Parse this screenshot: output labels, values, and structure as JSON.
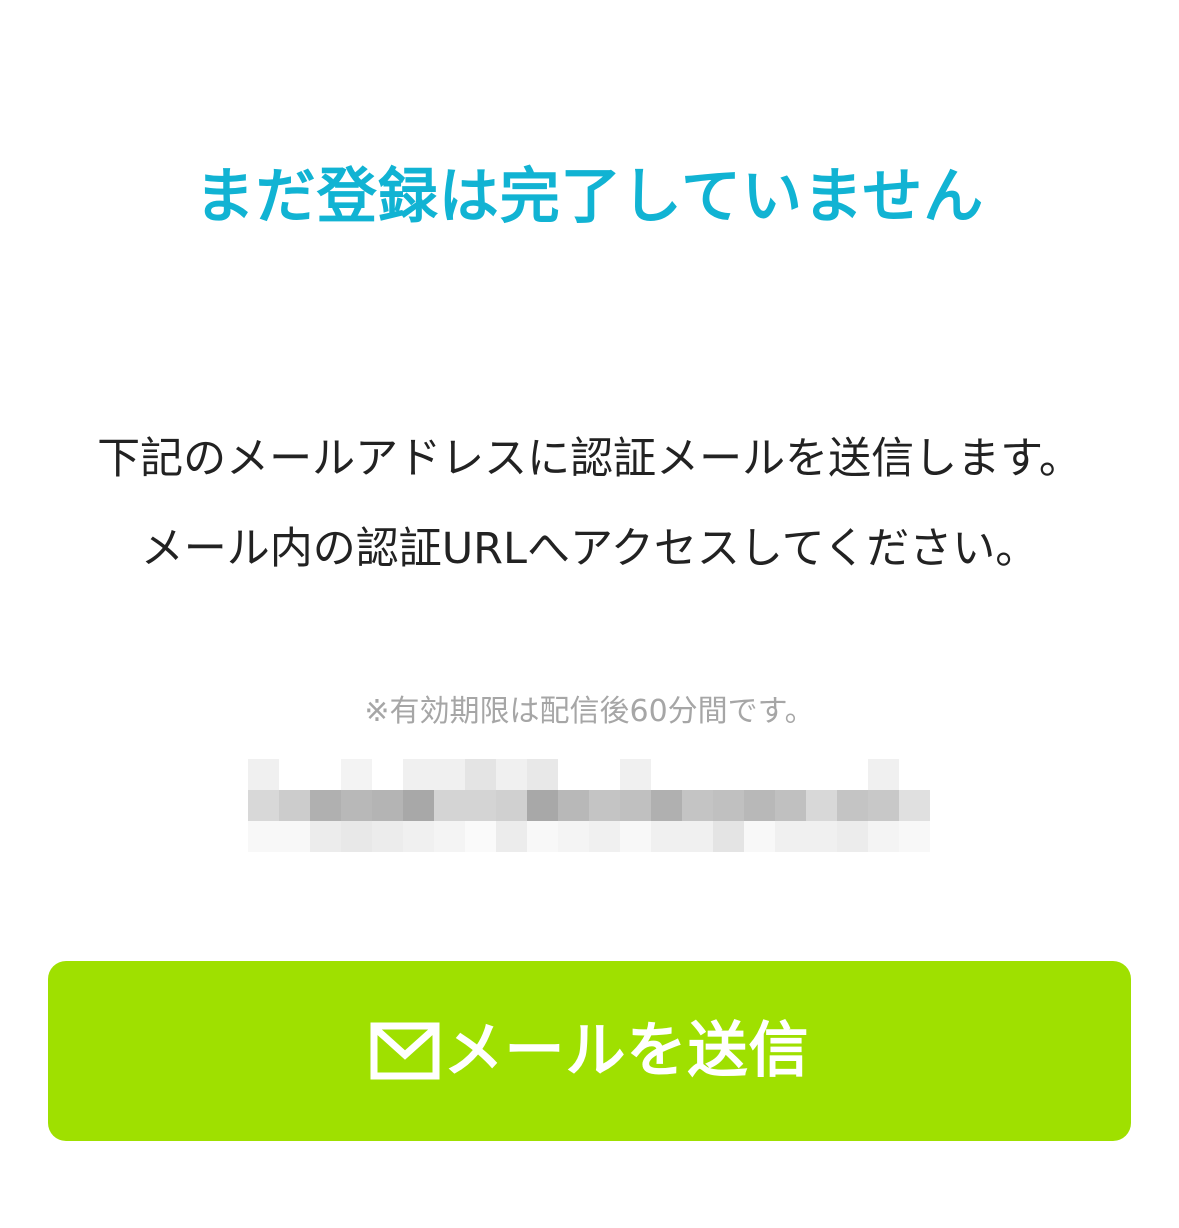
{
  "header": {
    "title": "まだ登録は完了していません"
  },
  "instructions": {
    "line1": "下記のメールアドレスに認証メールを送信します。",
    "line2": "メール内の認証URLへアクセスしてください。"
  },
  "notice": {
    "text": "※有効期限は配信後60分間です。"
  },
  "email": {
    "obscured": true
  },
  "send_button": {
    "label": "メールを送信",
    "icon": "mail-icon",
    "color": "#9fe000"
  },
  "colors": {
    "title": "#11b3d3",
    "body_text": "#222222",
    "notice_text": "#a6a6a6",
    "button_text": "#ffffff"
  }
}
